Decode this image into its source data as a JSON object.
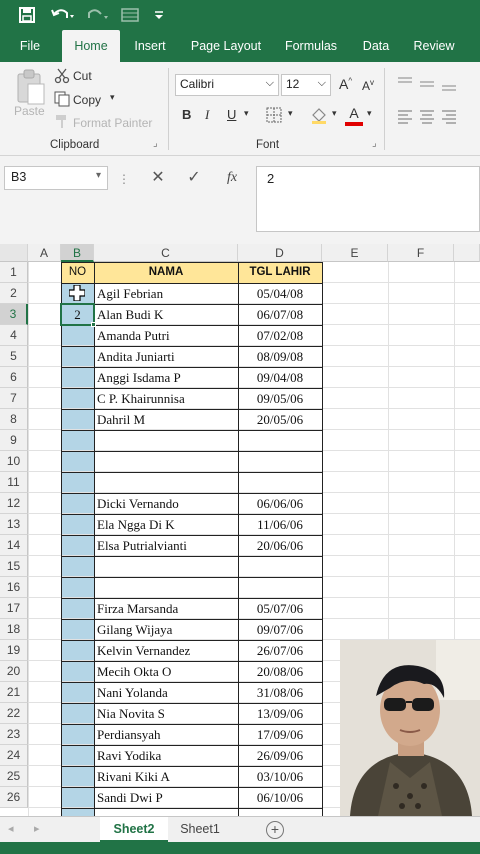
{
  "quick_access": {
    "save_icon": "save-icon",
    "undo_icon": "undo-icon",
    "redo_icon": "redo-icon",
    "form_icon": "form-icon",
    "customize_icon": "customize-icon"
  },
  "tabs": [
    "File",
    "Home",
    "Insert",
    "Page Layout",
    "Formulas",
    "Data",
    "Review"
  ],
  "active_tab": "Home",
  "ribbon": {
    "paste": "Paste",
    "cut": "Cut",
    "copy": "Copy",
    "format_painter": "Format Painter",
    "clipboard_label": "Clipboard",
    "font_name": "Calibri",
    "font_size": "12",
    "bold": "B",
    "italic": "I",
    "underline": "U",
    "font_label": "Font",
    "grow": "A",
    "shrink": "A",
    "font_color_letter": "A"
  },
  "formula_bar": {
    "name_box": "B3",
    "fx": "fx",
    "value": "2"
  },
  "columns": [
    "A",
    "B",
    "C",
    "D",
    "E",
    "F"
  ],
  "header_row": {
    "no": "NO",
    "nama": "NAMA",
    "tgl": "TGL LAHIR"
  },
  "rows": [
    {
      "n": "1"
    },
    {
      "n": "2",
      "no": "",
      "nama": "Agil Febrian",
      "tgl": "05/04/08"
    },
    {
      "n": "3",
      "no": "2",
      "nama": "Alan Budi K",
      "tgl": "06/07/08"
    },
    {
      "n": "4",
      "no": "",
      "nama": "Amanda Putri",
      "tgl": "07/02/08"
    },
    {
      "n": "5",
      "no": "",
      "nama": "Andita Juniarti",
      "tgl": "08/09/08"
    },
    {
      "n": "6",
      "no": "",
      "nama": "Anggi Isdama P",
      "tgl": "09/04/08"
    },
    {
      "n": "7",
      "no": "",
      "nama": "C P. Khairunnisa",
      "tgl": "09/05/06"
    },
    {
      "n": "8",
      "no": "",
      "nama": "Dahril M",
      "tgl": "20/05/06"
    },
    {
      "n": "9",
      "no": "",
      "nama": "",
      "tgl": ""
    },
    {
      "n": "10",
      "no": "",
      "nama": "",
      "tgl": ""
    },
    {
      "n": "11",
      "no": "",
      "nama": "",
      "tgl": ""
    },
    {
      "n": "12",
      "no": "",
      "nama": "Dicki Vernando",
      "tgl": "06/06/06"
    },
    {
      "n": "13",
      "no": "",
      "nama": "Ela Ngga Di K",
      "tgl": "11/06/06"
    },
    {
      "n": "14",
      "no": "",
      "nama": "Elsa Putrialvianti",
      "tgl": "20/06/06"
    },
    {
      "n": "15",
      "no": "",
      "nama": "",
      "tgl": ""
    },
    {
      "n": "16",
      "no": "",
      "nama": "",
      "tgl": ""
    },
    {
      "n": "17",
      "no": "",
      "nama": "Firza Marsanda",
      "tgl": "05/07/06"
    },
    {
      "n": "18",
      "no": "",
      "nama": "Gilang Wijaya",
      "tgl": "09/07/06"
    },
    {
      "n": "19",
      "no": "",
      "nama": "Kelvin Vernandez",
      "tgl": "26/07/06"
    },
    {
      "n": "20",
      "no": "",
      "nama": "Mecih Okta O",
      "tgl": "20/08/06"
    },
    {
      "n": "21",
      "no": "",
      "nama": "Nani Yolanda",
      "tgl": "31/08/06"
    },
    {
      "n": "22",
      "no": "",
      "nama": "Nia Novita S",
      "tgl": "13/09/06"
    },
    {
      "n": "23",
      "no": "",
      "nama": "Perdiansyah",
      "tgl": "17/09/06"
    },
    {
      "n": "24",
      "no": "",
      "nama": "Ravi Yodika",
      "tgl": "26/09/06"
    },
    {
      "n": "25",
      "no": "",
      "nama": "Rivani Kiki A",
      "tgl": "03/10/06"
    },
    {
      "n": "26",
      "no": "",
      "nama": "Sandi Dwi P",
      "tgl": "06/10/06"
    }
  ],
  "sheets": [
    "Sheet2",
    "Sheet1"
  ],
  "active_sheet": "Sheet2",
  "colors": {
    "excel_green": "#217346",
    "header_fill": "#ffe699",
    "selected_column_fill": "#b4d5e6",
    "border": "#222222"
  }
}
